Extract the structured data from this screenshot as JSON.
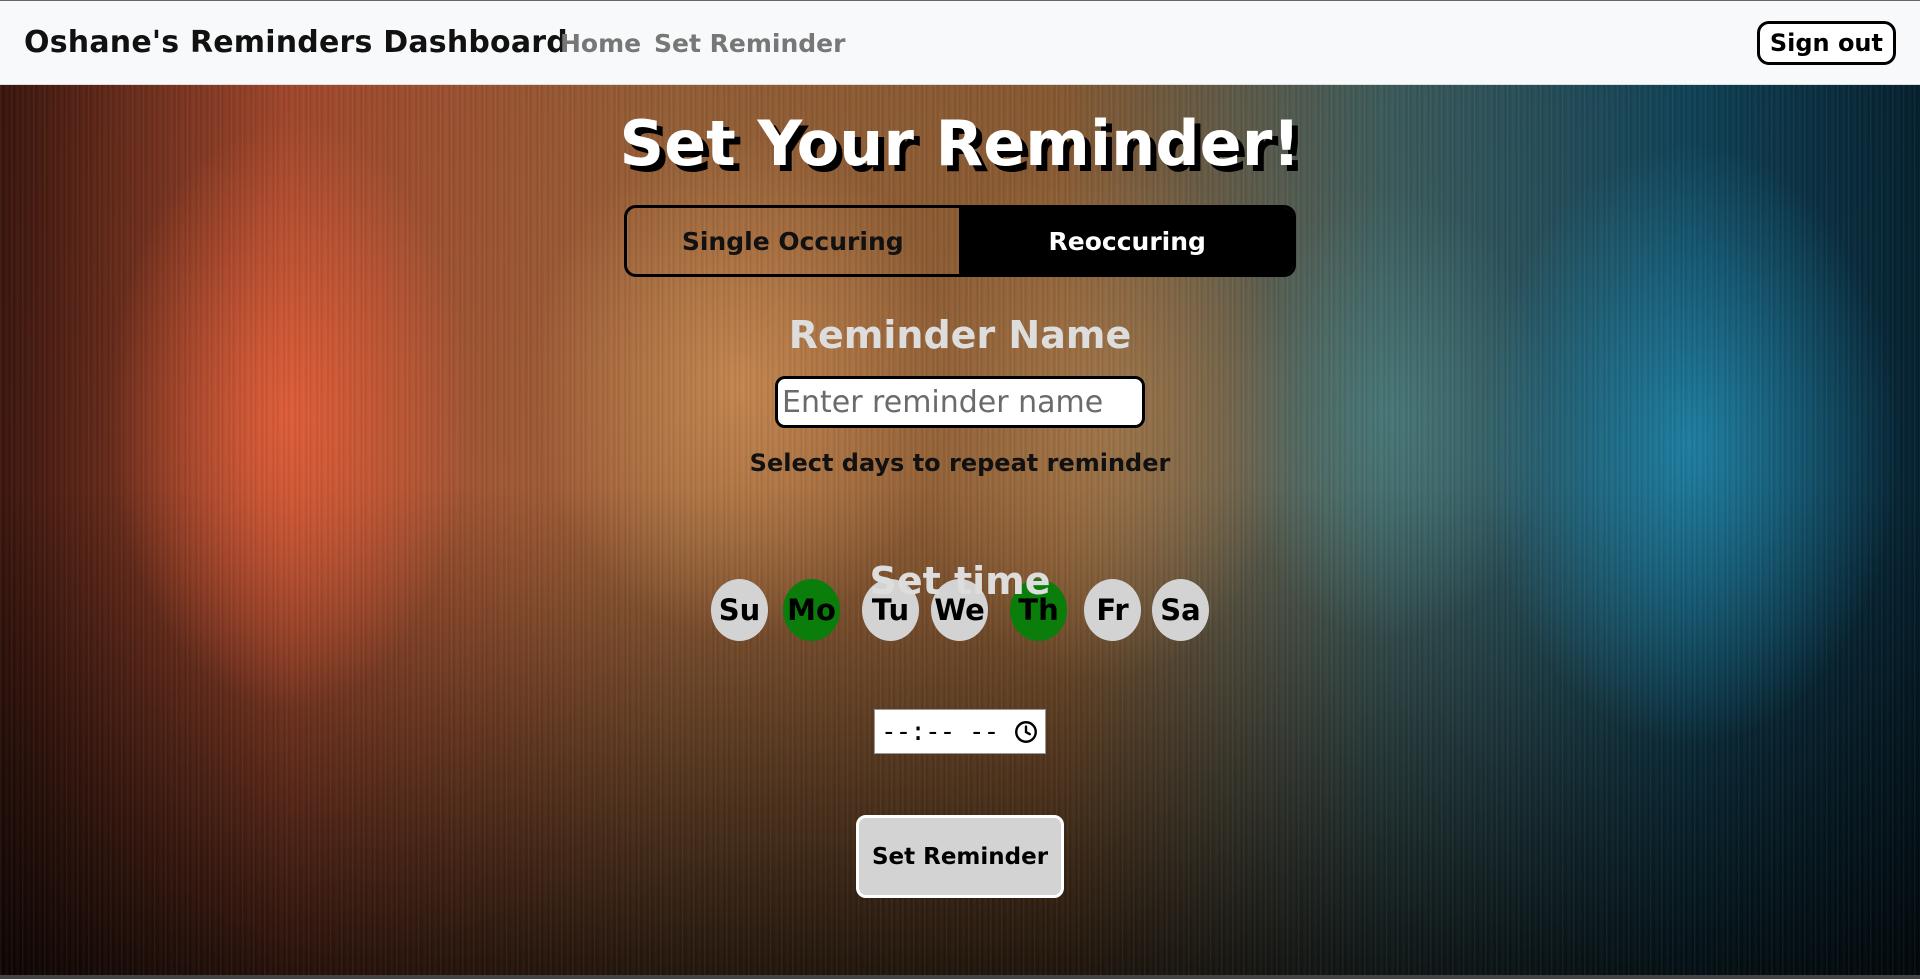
{
  "navbar": {
    "brand": "Oshane's Reminders Dashboard",
    "links": [
      {
        "label": "Home"
      },
      {
        "label": "Set Reminder"
      }
    ],
    "signout_label": "Sign out"
  },
  "main": {
    "title": "Set Your Reminder!",
    "toggle": {
      "options": [
        {
          "label": "Single Occuring",
          "active": false
        },
        {
          "label": "Reoccuring",
          "active": true
        }
      ]
    },
    "name_label": "Reminder Name",
    "name_input": {
      "value": "",
      "placeholder": "Enter reminder name"
    },
    "days_prompt": "Select days to repeat reminder",
    "days": [
      {
        "label": "Su",
        "selected": false
      },
      {
        "label": "Mo",
        "selected": true
      },
      {
        "label": "Tu",
        "selected": false
      },
      {
        "label": "We",
        "selected": false
      },
      {
        "label": "Th",
        "selected": true
      },
      {
        "label": "Fr",
        "selected": false
      },
      {
        "label": "Sa",
        "selected": false
      }
    ],
    "time_label": "Set time",
    "time_input": {
      "display": "--:-- --",
      "icon": "clock-icon"
    },
    "submit_label": "Set Reminder"
  },
  "colors": {
    "selected_day": "#0a7d0a",
    "unselected_day": "#d3d3d3",
    "toggle_active_bg": "#000000",
    "button_bg": "#d3d3d3"
  }
}
